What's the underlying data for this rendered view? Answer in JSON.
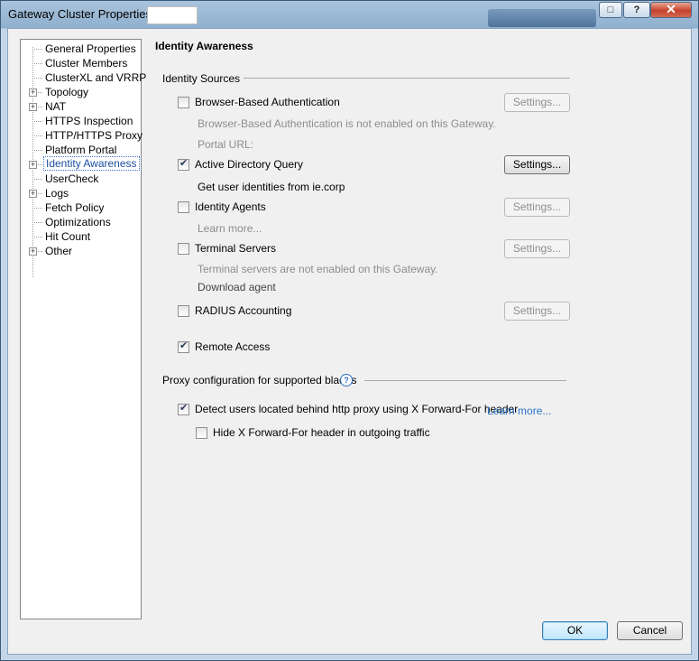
{
  "window": {
    "title": "Gateway Cluster Properties -"
  },
  "tree": {
    "items": [
      {
        "label": "General Properties",
        "expandable": false,
        "selected": false
      },
      {
        "label": "Cluster Members",
        "expandable": false,
        "selected": false
      },
      {
        "label": "ClusterXL and VRRP",
        "expandable": false,
        "selected": false
      },
      {
        "label": "Topology",
        "expandable": true,
        "selected": false
      },
      {
        "label": "NAT",
        "expandable": true,
        "selected": false
      },
      {
        "label": "HTTPS Inspection",
        "expandable": false,
        "selected": false
      },
      {
        "label": "HTTP/HTTPS Proxy",
        "expandable": false,
        "selected": false
      },
      {
        "label": "Platform Portal",
        "expandable": false,
        "selected": false
      },
      {
        "label": "Identity Awareness",
        "expandable": true,
        "selected": true
      },
      {
        "label": "UserCheck",
        "expandable": false,
        "selected": false
      },
      {
        "label": "Logs",
        "expandable": true,
        "selected": false
      },
      {
        "label": "Fetch Policy",
        "expandable": false,
        "selected": false
      },
      {
        "label": "Optimizations",
        "expandable": false,
        "selected": false
      },
      {
        "label": "Hit Count",
        "expandable": false,
        "selected": false
      },
      {
        "label": "Other",
        "expandable": true,
        "selected": false
      }
    ]
  },
  "panel": {
    "title": "Identity Awareness",
    "identity_sources": {
      "heading": "Identity Sources",
      "browser_auth": {
        "label": "Browser-Based Authentication",
        "checked": false,
        "note": "Browser-Based Authentication is not enabled on this Gateway.",
        "portal": "Portal URL:",
        "settings": "Settings..."
      },
      "ad_query": {
        "label": "Active Directory Query",
        "checked": true,
        "note": "Get user identities from ie.corp",
        "settings": "Settings..."
      },
      "identity_agents": {
        "label": "Identity Agents",
        "checked": false,
        "note": "Learn more...",
        "settings": "Settings..."
      },
      "terminal_servers": {
        "label": "Terminal Servers",
        "checked": false,
        "note": "Terminal servers are not enabled on this Gateway.",
        "download": "Download agent",
        "settings": "Settings..."
      },
      "radius": {
        "label": "RADIUS Accounting",
        "checked": false,
        "settings": "Settings..."
      },
      "remote_access": {
        "label": "Remote Access",
        "checked": true
      }
    },
    "proxy": {
      "heading": "Proxy configuration for supported blades",
      "help_icon": "?",
      "detect": {
        "label": "Detect users located behind http proxy using X Forward-For header",
        "checked": true,
        "learn_more": "Learn more..."
      },
      "hide": {
        "label": "Hide X Forward-For header in outgoing traffic",
        "checked": false
      }
    }
  },
  "footer": {
    "ok": "OK",
    "cancel": "Cancel"
  }
}
